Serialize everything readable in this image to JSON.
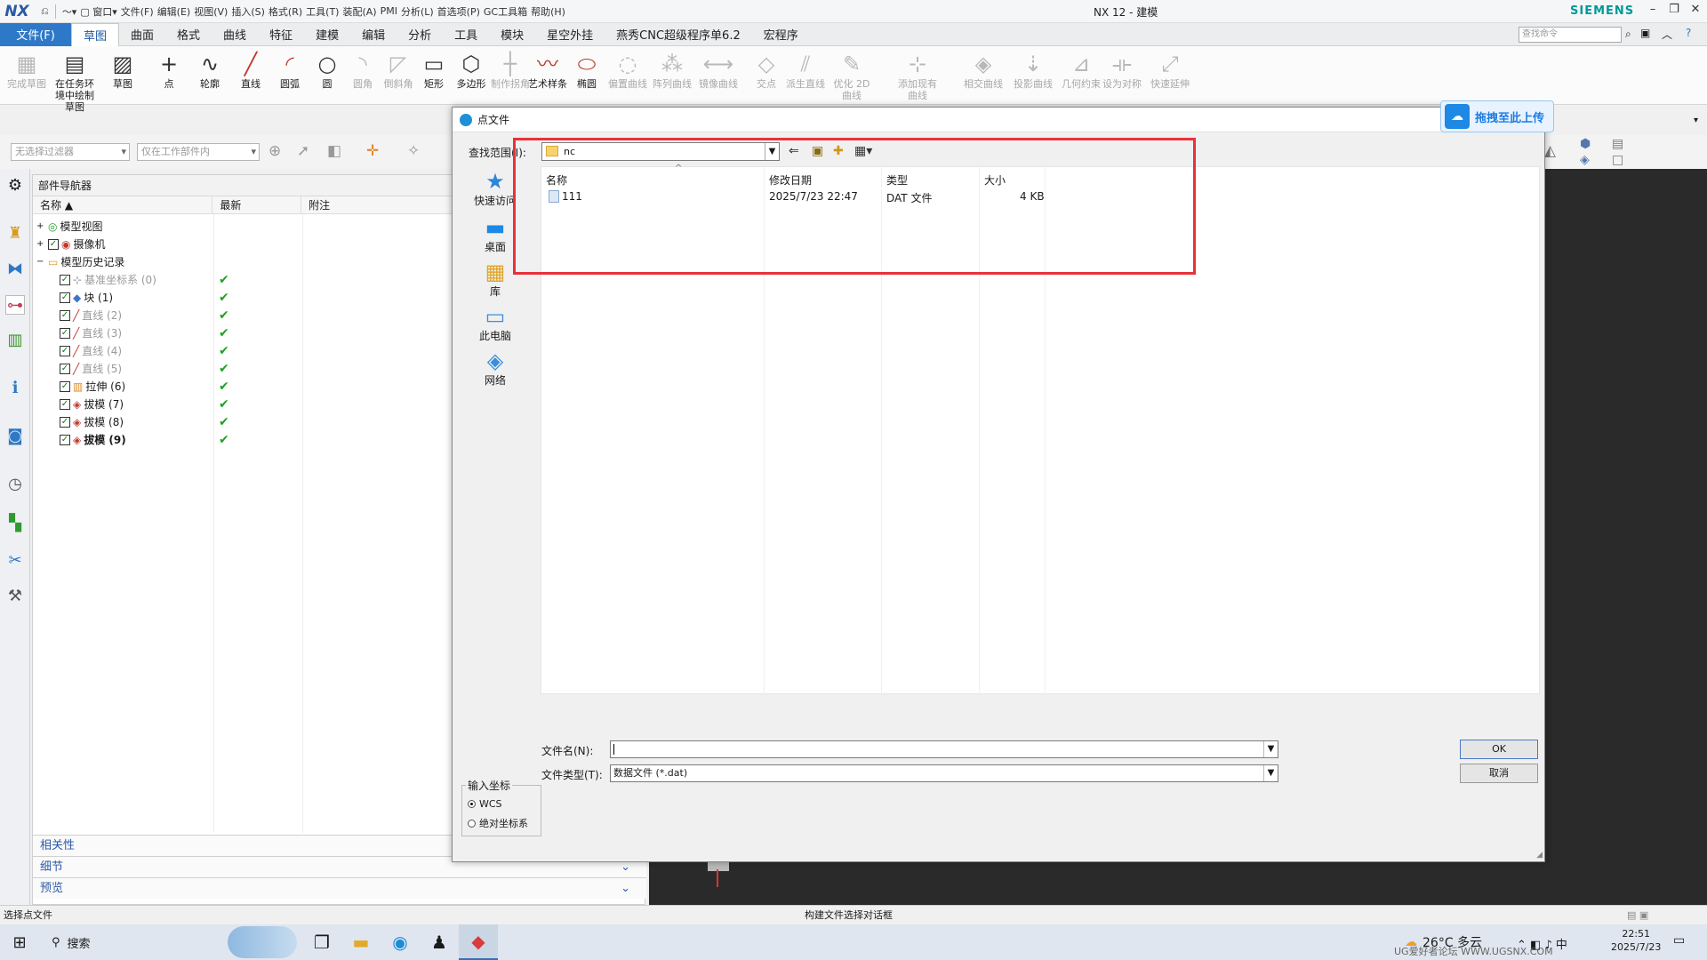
{
  "app": {
    "logo": "NX",
    "title": "NX 12 - 建模",
    "brand": "SIEMENS",
    "quick_access": [
      "窗口",
      "文件(F)",
      "编辑(E)",
      "视图(V)",
      "插入(S)",
      "格式(R)",
      "工具(T)",
      "装配(A)",
      "PMI",
      "分析(L)",
      "首选项(P)",
      "GC工具箱",
      "帮助(H)"
    ]
  },
  "ribbon_tabs": {
    "file": "文件(F)",
    "items": [
      "草图",
      "曲面",
      "格式",
      "曲线",
      "特征",
      "建模",
      "编辑",
      "分析",
      "工具",
      "模块",
      "星空外挂",
      "燕秀CNC超级程序单6.2",
      "宏程序"
    ],
    "active": "草图",
    "search_placeholder": "查找命令"
  },
  "ribbon": [
    {
      "label": "完成草图",
      "icon": "finish-sketch-icon",
      "enabled": false
    },
    {
      "label": "在任务环境中绘制草图",
      "icon": "sketch-task-icon",
      "enabled": true
    },
    {
      "label": "草图",
      "icon": "sketch-icon",
      "enabled": true
    },
    {
      "label": "点",
      "icon": "point-icon",
      "enabled": true
    },
    {
      "label": "轮廓",
      "icon": "profile-icon",
      "enabled": true
    },
    {
      "label": "直线",
      "icon": "line-icon",
      "enabled": true
    },
    {
      "label": "圆弧",
      "icon": "arc-icon",
      "enabled": true
    },
    {
      "label": "圆",
      "icon": "circle-icon",
      "enabled": true
    },
    {
      "label": "圆角",
      "icon": "fillet-icon",
      "enabled": false
    },
    {
      "label": "倒斜角",
      "icon": "chamfer-icon",
      "enabled": false
    },
    {
      "label": "矩形",
      "icon": "rectangle-icon",
      "enabled": true
    },
    {
      "label": "多边形",
      "icon": "polygon-icon",
      "enabled": true
    },
    {
      "label": "制作拐角",
      "icon": "make-corner-icon",
      "enabled": false
    },
    {
      "label": "艺术样条",
      "icon": "spline-icon",
      "enabled": true
    },
    {
      "label": "椭圆",
      "icon": "ellipse-icon",
      "enabled": true
    },
    {
      "label": "偏置曲线",
      "icon": "offset-curve-icon",
      "enabled": false
    },
    {
      "label": "阵列曲线",
      "icon": "pattern-curve-icon",
      "enabled": false
    },
    {
      "label": "镜像曲线",
      "icon": "mirror-curve-icon",
      "enabled": false
    },
    {
      "label": "交点",
      "icon": "intersection-icon",
      "enabled": false
    },
    {
      "label": "派生直线",
      "icon": "derived-line-icon",
      "enabled": false
    },
    {
      "label": "优化 2D 曲线",
      "icon": "optimize-curve-icon",
      "enabled": false
    },
    {
      "label": "添加现有曲线",
      "icon": "add-curve-icon",
      "enabled": false
    },
    {
      "label": "相交曲线",
      "icon": "intersect-curve-icon",
      "enabled": false
    },
    {
      "label": "投影曲线",
      "icon": "project-curve-icon",
      "enabled": false
    },
    {
      "label": "几何约束",
      "icon": "constraint-icon",
      "enabled": false
    },
    {
      "label": "设为对称",
      "icon": "symmetric-icon",
      "enabled": false
    },
    {
      "label": "快速延伸",
      "icon": "quick-extend-icon",
      "enabled": false
    }
  ],
  "toolbar2": {
    "filter": "无选择过滤器",
    "scope": "仅在工作部件内"
  },
  "navigator": {
    "title": "部件导航器",
    "columns": [
      "名称",
      "最新",
      "附注"
    ],
    "rows": [
      {
        "label": "模型视图",
        "level": 0,
        "gray": false,
        "tick": false,
        "bold": false,
        "icon": "model-views-icon"
      },
      {
        "label": "摄像机",
        "level": 0,
        "gray": false,
        "tick": false,
        "bold": false,
        "icon": "camera-icon"
      },
      {
        "label": "模型历史记录",
        "level": 0,
        "gray": false,
        "tick": false,
        "bold": false,
        "icon": "folder-icon"
      },
      {
        "label": "基准坐标系 (0)",
        "level": 1,
        "gray": true,
        "tick": true,
        "bold": false,
        "icon": "datum-csys-icon"
      },
      {
        "label": "块 (1)",
        "level": 1,
        "gray": false,
        "tick": true,
        "bold": false,
        "icon": "block-icon"
      },
      {
        "label": "直线 (2)",
        "level": 1,
        "gray": true,
        "tick": true,
        "bold": false,
        "icon": "line-feature-icon"
      },
      {
        "label": "直线 (3)",
        "level": 1,
        "gray": true,
        "tick": true,
        "bold": false,
        "icon": "line-feature-icon"
      },
      {
        "label": "直线 (4)",
        "level": 1,
        "gray": true,
        "tick": true,
        "bold": false,
        "icon": "line-feature-icon"
      },
      {
        "label": "直线 (5)",
        "level": 1,
        "gray": true,
        "tick": true,
        "bold": false,
        "icon": "line-feature-icon"
      },
      {
        "label": "拉伸 (6)",
        "level": 1,
        "gray": false,
        "tick": true,
        "bold": false,
        "icon": "extrude-icon"
      },
      {
        "label": "拔模 (7)",
        "level": 1,
        "gray": false,
        "tick": true,
        "bold": false,
        "icon": "draft-icon"
      },
      {
        "label": "拔模 (8)",
        "level": 1,
        "gray": false,
        "tick": true,
        "bold": false,
        "icon": "draft-icon"
      },
      {
        "label": "拔模 (9)",
        "level": 1,
        "gray": false,
        "tick": true,
        "bold": true,
        "icon": "draft-icon"
      }
    ],
    "panels": [
      "相关性",
      "细节",
      "预览"
    ]
  },
  "dialog": {
    "title": "点文件",
    "look_in_label": "查找范围(I):",
    "look_in_value": "nc",
    "places": [
      "快速访问",
      "桌面",
      "库",
      "此电脑",
      "网络"
    ],
    "columns": [
      "名称",
      "修改日期",
      "类型",
      "大小"
    ],
    "files": [
      {
        "name": "111",
        "modified": "2025/7/23 22:47",
        "type": "DAT 文件",
        "size": "4 KB"
      }
    ],
    "filename_label": "文件名(N):",
    "filename_value": "",
    "filetype_label": "文件类型(T):",
    "filetype_value": "数据文件 (*.dat)",
    "ok": "OK",
    "cancel": "取消",
    "coord_group": "输入坐标",
    "coord_options": [
      "WCS",
      "绝对坐标系"
    ],
    "coord_selected": "WCS"
  },
  "overlay": {
    "upload_label": "拖拽至此上传"
  },
  "status": {
    "left": "选择点文件",
    "center": "构建文件选择对话框"
  },
  "taskbar": {
    "search": "搜索",
    "weather": "26°C 多云",
    "time": "22:51",
    "date": "2025/7/23",
    "watermark": "UG爱好者论坛 WWW.UGSNX.COM"
  },
  "colors": {
    "accent": "#2e79c7",
    "highlight_box": "#e8313a",
    "check_green": "#1ea21e",
    "brand": "#009999"
  }
}
